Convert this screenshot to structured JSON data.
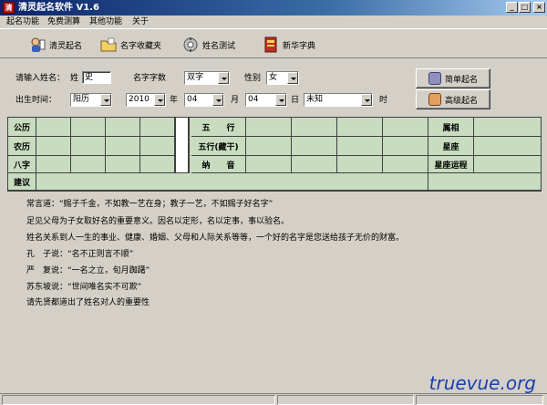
{
  "window": {
    "title": "清灵起名软件 V1.6",
    "icon_text": "清",
    "minimize": "_",
    "maximize": "□",
    "close": "×"
  },
  "menu": [
    "起名功能",
    "免费测算",
    "其他功能",
    "关于"
  ],
  "toolbar": [
    {
      "label": "清灵起名",
      "icon": "name-icon"
    },
    {
      "label": "名字收藏夹",
      "icon": "folder-icon"
    },
    {
      "label": "姓名测试",
      "icon": "gear-icon"
    },
    {
      "label": "新华字典",
      "icon": "book-icon"
    }
  ],
  "form": {
    "surname_label": "请输入姓名：",
    "surname_prefix": "姓",
    "surname_value": "史",
    "char_count_label": "名字字数",
    "char_count_value": "双字",
    "gender_label": "性别",
    "gender_value": "女",
    "birth_label": "出生时间：",
    "calendar_value": "阳历",
    "year_value": "2010",
    "year_unit": "年",
    "month_value": "04",
    "month_unit": "月",
    "day_value": "04",
    "day_unit": "日",
    "hour_value": "未知",
    "hour_unit": "时",
    "simple_button": "简单起名",
    "advanced_button": "高级起名"
  },
  "grid": {
    "row_labels": [
      "公历",
      "农历",
      "八字",
      "建议"
    ],
    "mid_labels": [
      "五　　行",
      "五行(藏干)",
      "纳　　音"
    ],
    "right_labels": [
      "属相",
      "星座",
      "星座运程"
    ]
  },
  "paragraphs": [
    "常言道：“赐子千金，不如教一艺在身；教子一艺，不如赐子好名字”",
    "足见父母为子女取好名的重要意义。因名以定形，名以定事，事以验名。",
    "姓名关系到人一生的事业、健康、婚姻、父母和人际关系等等，一个好的名字是您送给孩子无价的财富。",
    "孔　子说：“名不正则言不顺”",
    "严　复说：“一名之立，旬月踟躇”",
    "苏东坡说：“世间唯名实不可欺”",
    "请先贤都道出了姓名对人的重要性"
  ],
  "watermark": "truevue.org"
}
